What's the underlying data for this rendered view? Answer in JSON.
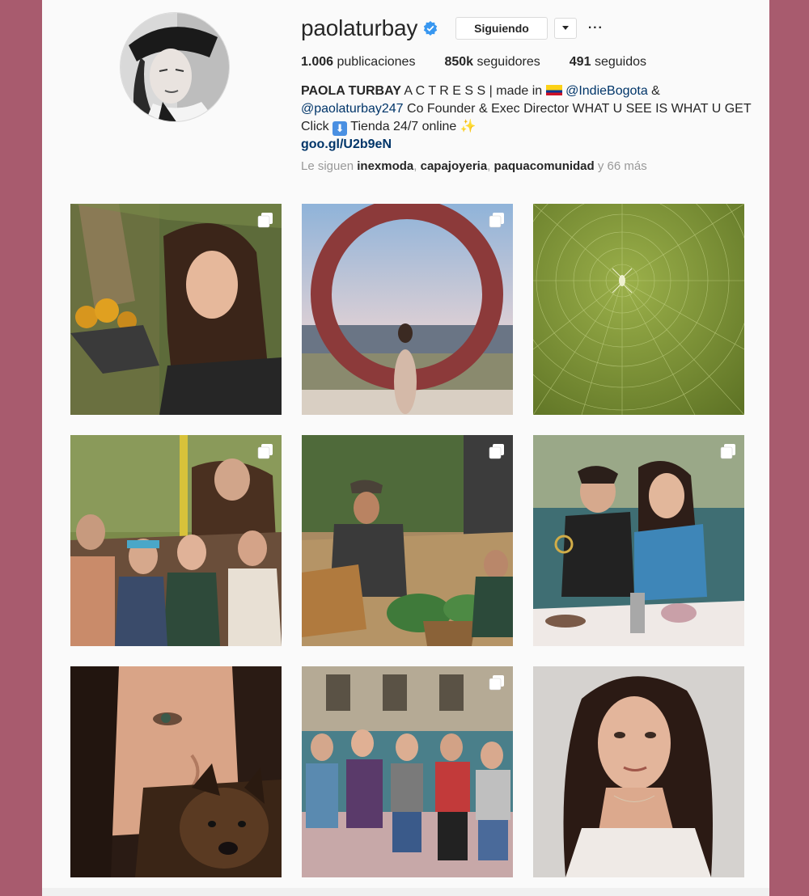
{
  "profile": {
    "username": "paolaturbay",
    "following_button": "Siguiendo",
    "more_label": "···",
    "stats": {
      "posts_value": "1.006",
      "posts_label": "publicaciones",
      "followers_value": "850k",
      "followers_label": "seguidores",
      "following_value": "491",
      "following_label": "seguidos"
    },
    "bio": {
      "name": "PAOLA TURBAY",
      "line1_text": " A C T R E S S | made in ",
      "mention1": "@IndieBogota",
      "amp": " &",
      "mention2": "@paolaturbay247",
      "line2_text": " Co Founder & Exec Director WHAT U SEE IS WHAT U GET Click ",
      "line2_tail": " Tienda 24/7 online ",
      "down_emoji": "⬇",
      "sparkle": "✨",
      "link": "goo.gl/U2b9eN"
    },
    "followed_by": {
      "prefix": "Le siguen ",
      "user1": "inexmoda",
      "sep1": ", ",
      "user2": "capajoyeria",
      "sep2": ", ",
      "user3": "paquacomunidad",
      "suffix": " y 66 más"
    }
  },
  "colors": {
    "background": "#a85b6e",
    "panel": "#fafafa",
    "verified": "#3897f0",
    "link": "#003569"
  },
  "posts": [
    {
      "id": "post-1",
      "multi": true,
      "subject": "woman-with-oranges"
    },
    {
      "id": "post-2",
      "multi": true,
      "subject": "red-ring-sculpture"
    },
    {
      "id": "post-3",
      "multi": false,
      "subject": "spider-web"
    },
    {
      "id": "post-4",
      "multi": true,
      "subject": "group-in-garden"
    },
    {
      "id": "post-5",
      "multi": true,
      "subject": "farm-harvest"
    },
    {
      "id": "post-6",
      "multi": true,
      "subject": "couple-at-tea"
    },
    {
      "id": "post-7",
      "multi": false,
      "subject": "woman-with-puppy"
    },
    {
      "id": "post-8",
      "multi": true,
      "subject": "women-on-sofa"
    },
    {
      "id": "post-9",
      "multi": false,
      "subject": "portrait"
    }
  ]
}
